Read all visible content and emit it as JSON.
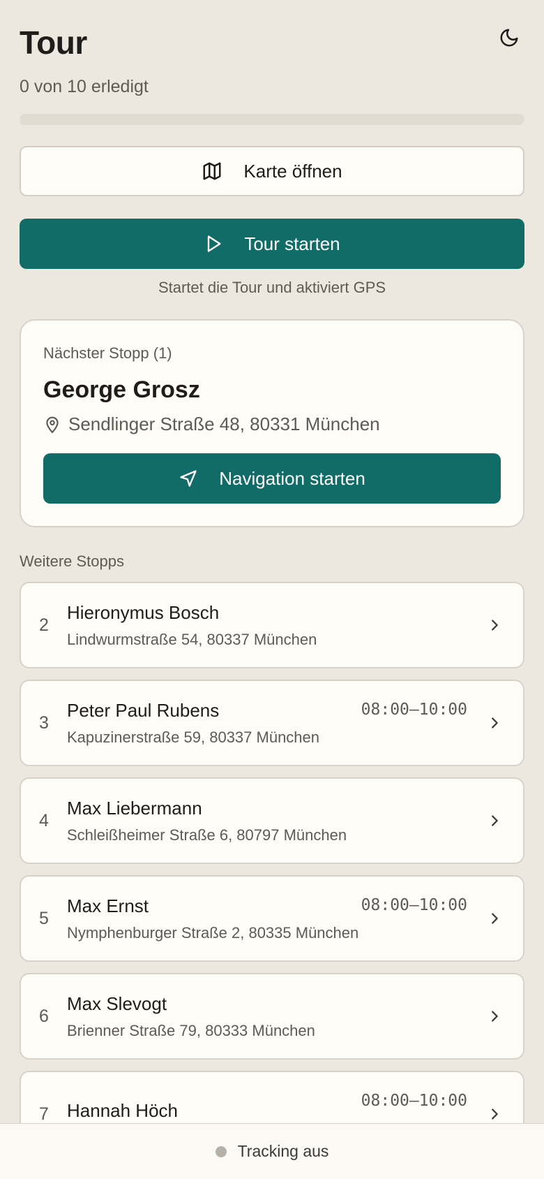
{
  "header": {
    "title": "Tour",
    "theme_icon": "moon-icon"
  },
  "progress": {
    "text": "0 von 10 erledigt",
    "done": 0,
    "total": 10,
    "fraction": 0
  },
  "actions": {
    "map_label": "Karte öffnen",
    "map_icon": "map-icon",
    "start_label": "Tour starten",
    "start_icon": "play-icon",
    "start_hint": "Startet die Tour und aktiviert GPS"
  },
  "next_stop": {
    "label": "Nächster Stopp (1)",
    "name": "George Grosz",
    "address": "Sendlinger Straße 48, 80331 München",
    "nav_label": "Navigation starten",
    "nav_icon": "navigation-arrow-icon"
  },
  "stops_section": {
    "label": "Weitere Stopps"
  },
  "stops": [
    {
      "num": "2",
      "name": "Hieronymus Bosch",
      "address": "Lindwurmstraße 54, 80337 München",
      "time": ""
    },
    {
      "num": "3",
      "name": "Peter Paul Rubens",
      "address": "Kapuzinerstraße 59, 80337 München",
      "time": "08:00–10:00"
    },
    {
      "num": "4",
      "name": "Max Liebermann",
      "address": "Schleißheimer Straße 6, 80797 München",
      "time": ""
    },
    {
      "num": "5",
      "name": "Max Ernst",
      "address": "Nymphenburger Straße 2, 80335 München",
      "time": "08:00–10:00"
    },
    {
      "num": "6",
      "name": "Max Slevogt",
      "address": "Brienner Straße 79, 80333 München",
      "time": ""
    },
    {
      "num": "7",
      "name": "Hannah Höch",
      "address": "",
      "time": "08:00–10:00"
    }
  ],
  "tracking": {
    "label": "Tracking aus",
    "status_color": "#B6B1A8"
  },
  "colors": {
    "accent": "#116B66",
    "background": "#ECE8DF",
    "card": "#FEFCF6"
  }
}
